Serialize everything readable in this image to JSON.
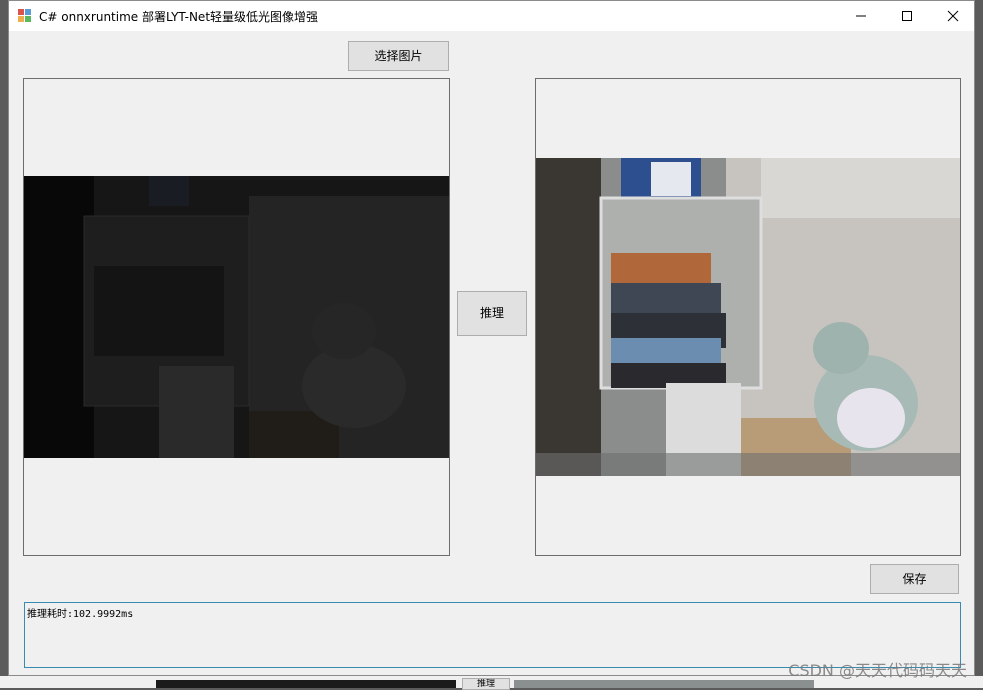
{
  "window": {
    "title": "C# onnxruntime 部署LYT-Net轻量级低光图像增强",
    "minimize": "—",
    "maximize": "☐",
    "close": "✕"
  },
  "buttons": {
    "select_image": "选择图片",
    "infer": "推理",
    "save": "保存"
  },
  "log": {
    "text": "推理耗时:102.9992ms"
  },
  "watermark": "CSDN @天天代码码天天",
  "background_window": {
    "button_label": "推理"
  },
  "colors": {
    "form_bg": "#f0f0f0",
    "button_bg": "#e1e1e1",
    "log_border": "#3a8bb0",
    "dark_image": "#161616"
  }
}
